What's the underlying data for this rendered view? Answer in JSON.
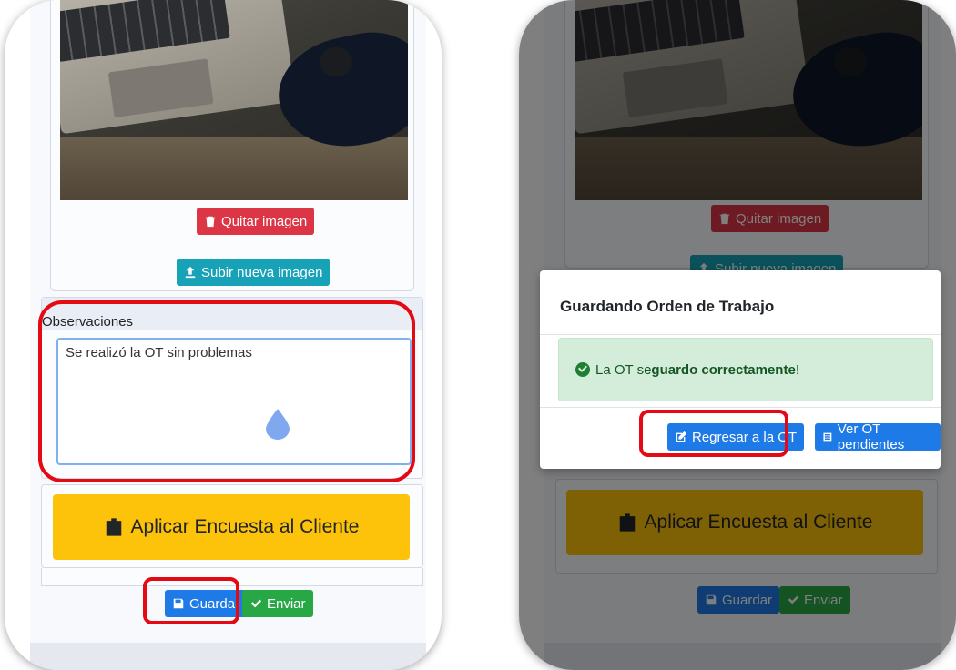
{
  "left_screen": {
    "remove_image_label": "Quitar imagen",
    "upload_image_label": "Subir nueva imagen",
    "observations_label": "Observaciones",
    "observations_value": "Se realizó la OT sin problemas",
    "survey_label": "Aplicar Encuesta al Cliente",
    "save_label": "Guardar",
    "send_label": "Enviar"
  },
  "right_screen": {
    "remove_image_label": "Quitar imagen",
    "upload_image_label": "Subir nueva imagen",
    "modal": {
      "title": "Guardando Orden de Trabajo",
      "alert_prefix": "La OT se ",
      "alert_bold": "guardo correctamente",
      "alert_suffix": "!",
      "back_label": "Regresar a la OT",
      "pending_label": "Ver OT pendientes"
    },
    "survey_label": "Aplicar Encuesta al Cliente",
    "save_label": "Guardar",
    "send_label": "Enviar"
  },
  "icons": {
    "trash": "trash-icon",
    "upload": "upload-icon",
    "clipboard": "clipboard-user-icon",
    "save": "floppy-disk-icon",
    "check": "check-icon",
    "edit": "edit-icon",
    "list": "list-icon",
    "success": "check-circle-icon",
    "touch": "touch-indicator-icon"
  },
  "colors": {
    "danger": "#dc3545",
    "info": "#17a2b8",
    "primary": "#1e7ae6",
    "success": "#28a745",
    "warning": "#fdc20a",
    "highlight": "#e50914"
  }
}
